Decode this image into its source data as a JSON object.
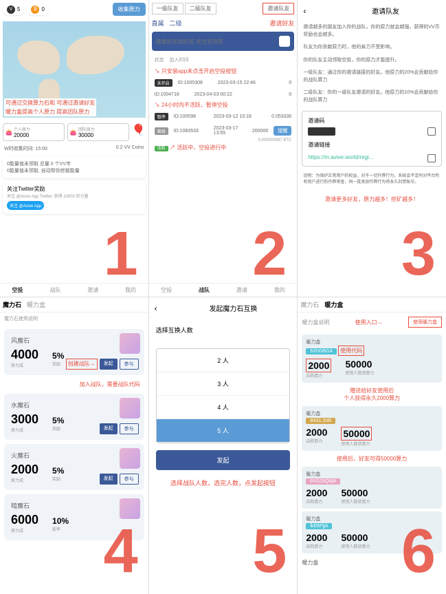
{
  "panel1": {
    "vv_label": "VV",
    "vv_value": "5",
    "btc_label": "BTC",
    "btc_value": "0",
    "top_btn": "收集原力",
    "map_label1": "可通过交换算力石和",
    "map_label2": "可通过邀请好友",
    "map_label3": "暖力盒提高个人原力",
    "map_label4": "提高团队原力",
    "box1_label": "个人原力",
    "box1_value": "20000",
    "box2_label": "团队原力",
    "box2_value": "30000",
    "time_label": "W时收集时间: 15:00",
    "coins": "0.2 VV Coins",
    "card1_line1": "0能量值未领取 总量 0 个VV市",
    "card1_line2": "0能量值未领取, 自动帮你挖掘能量",
    "twitter_title": "关注Twitter奖励",
    "twitter_sub": "关注 @Avive App Twitter, 获得 10000 的力量",
    "tabs": [
      "空投",
      "战队",
      "邀请",
      "我的"
    ]
  },
  "panel2": {
    "header_tabs": [
      "一级队友",
      "二级队友"
    ],
    "header_btn": "邀请队友",
    "lbl_direct": "直属",
    "lbl_second": "二级",
    "lbl_invite": "邀请好友",
    "search_placeholder": "搜索好友找好友 关注支持奖",
    "cols": [
      "状态",
      "加入时间"
    ],
    "annotation1": "只安装app未点击开启空投按钮",
    "row1_id": "ID:1005308",
    "row1_date": "2023-03-15 22:46",
    "row1_val": "0",
    "row2_id": "ID:1004716",
    "row2_date": "2023-04-03 00:22",
    "row2_val": "0",
    "annotation2": "24小时内不活跃，暂停空投",
    "row3_id": "ID:100598",
    "row3_date": "2023-03-12 10:18",
    "row3_val": "0.053336",
    "row4_id": "ID:1083533",
    "row4_date": "2023-03-17 13:55",
    "row4_val": "200000",
    "row4_btn": "提醒",
    "row4_sub": "0.000000087 BTC",
    "annotation3": "活跃中，空投进行中",
    "tabs": [
      "空投",
      "战队",
      "邀请",
      "我的"
    ]
  },
  "panel3": {
    "title": "邀请队友",
    "para1": "邀请越多的朋友加入你的战队，你的原力就会越强，获得的VV币奖励也会越多。",
    "para2": "队友为你贡献原力时，他的亲力不受影响。",
    "para3": "你的队友主动领取空投，你的原力才能提升。",
    "para4": "一级队友：通过你的邀请链接的好友。他原力的20%会贡献给你的战队算力",
    "para5": "二级队友：你的一级队友邀请的好友。他原力的10%会贡献给你的战队算力",
    "code_label": "邀请码",
    "link_label": "邀请链接",
    "link_url": "https://m.avive.world/regi...",
    "note": "说明：为保护正常用户的权益，对于一切作弊行为，系统会不定时对平台所有用户进行防作弊审查，同一批发放作弊行为将永久封禁账号。",
    "cta": "邀请更多好友，原力越多！挖矿越多！"
  },
  "panel4": {
    "tabs": [
      "魔力石",
      "暖力盒"
    ],
    "sub": "魔力石使用说明",
    "stones": [
      {
        "name": "风魔石",
        "value": "4000",
        "pct": "5%",
        "sub1": "原力成",
        "sub2": "奖励"
      },
      {
        "name": "水魔石",
        "value": "3000",
        "pct": "5%",
        "sub1": "原力成",
        "sub2": "奖励"
      },
      {
        "name": "火魔石",
        "value": "2000",
        "pct": "5%",
        "sub1": "原力成",
        "sub2": "奖励"
      },
      {
        "name": "暗魔石",
        "value": "6000",
        "pct": "10%",
        "sub1": "原力成",
        "sub2": "能率"
      }
    ],
    "btn1": "发起",
    "btn2": "参与",
    "annotation1": "创建战队",
    "annotation2": "加入战队，需要战队代码"
  },
  "panel5": {
    "title": "发起魔力石互换",
    "sub": "选择互换人数",
    "options": [
      "2 人",
      "3 人",
      "4 人"
    ],
    "selected": "5 人",
    "btn": "发起",
    "note": "选择战队人数，选完人数，点发起按钮"
  },
  "panel6": {
    "tabs": [
      "魔力石",
      "暖力盒"
    ],
    "sub": "暖力盒说明",
    "entry_label": "使用入口",
    "entry_btn": "使用暖力盒",
    "gift_label": "暖力盒",
    "code1": "6XhGBGA",
    "use_code": "使用代码",
    "val1": "2000",
    "val2": "50000",
    "sub1": "自购算力",
    "sub2": "使用人数获算力",
    "note1": "赠送给好友使用后",
    "note2": "个人获得永久2000算力",
    "code2": "B431.Sd9",
    "note3": "使用后，好友可得50000算力",
    "code3": "6XG20QBjA",
    "code4": "lkE8PjjA",
    "last": "暖力盒"
  },
  "bignums": [
    "1",
    "2",
    "3",
    "4",
    "5",
    "6"
  ]
}
